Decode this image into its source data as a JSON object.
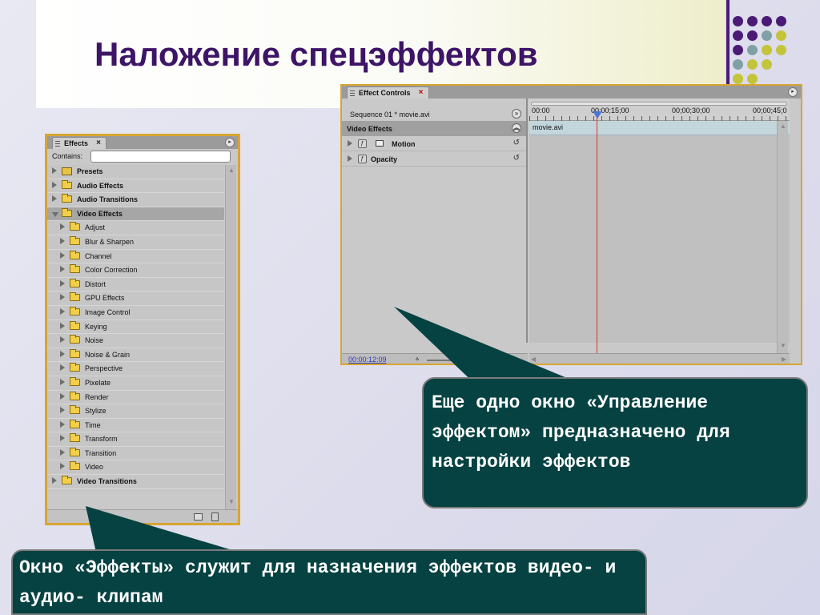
{
  "slide": {
    "title": "Наложение спецэффектов",
    "colors": {
      "title": "#3d1466",
      "callout_bg": "#064242",
      "accent_bar": "#4a1a75"
    },
    "decoration_dot_colors": [
      "#4a1a75",
      "#7fa1a6",
      "#c4c43a"
    ]
  },
  "effects_panel": {
    "tab_label": "Effects",
    "close_label": "×",
    "contains_label": "Contains:",
    "contains_value": "",
    "items": [
      {
        "label": "Presets",
        "level": 0,
        "open": false,
        "bold": true,
        "icon": "presets-icon"
      },
      {
        "label": "Audio Effects",
        "level": 0,
        "open": false,
        "bold": true,
        "icon": "folder-icon"
      },
      {
        "label": "Audio Transitions",
        "level": 0,
        "open": false,
        "bold": true,
        "icon": "folder-icon"
      },
      {
        "label": "Video Effects",
        "level": 0,
        "open": true,
        "bold": true,
        "selected": true,
        "icon": "folder-icon"
      },
      {
        "label": "Adjust",
        "level": 1,
        "icon": "folder-icon"
      },
      {
        "label": "Blur & Sharpen",
        "level": 1,
        "icon": "folder-icon"
      },
      {
        "label": "Channel",
        "level": 1,
        "icon": "folder-icon"
      },
      {
        "label": "Color Correction",
        "level": 1,
        "icon": "folder-icon"
      },
      {
        "label": "Distort",
        "level": 1,
        "icon": "folder-icon"
      },
      {
        "label": "GPU Effects",
        "level": 1,
        "icon": "folder-icon"
      },
      {
        "label": "Image Control",
        "level": 1,
        "icon": "folder-icon"
      },
      {
        "label": "Keying",
        "level": 1,
        "icon": "folder-icon"
      },
      {
        "label": "Noise",
        "level": 1,
        "icon": "folder-icon"
      },
      {
        "label": "Noise & Grain",
        "level": 1,
        "icon": "folder-icon"
      },
      {
        "label": "Perspective",
        "level": 1,
        "icon": "folder-icon"
      },
      {
        "label": "Pixelate",
        "level": 1,
        "icon": "folder-icon"
      },
      {
        "label": "Render",
        "level": 1,
        "icon": "folder-icon"
      },
      {
        "label": "Stylize",
        "level": 1,
        "icon": "folder-icon"
      },
      {
        "label": "Time",
        "level": 1,
        "icon": "folder-icon"
      },
      {
        "label": "Transform",
        "level": 1,
        "icon": "folder-icon"
      },
      {
        "label": "Transition",
        "level": 1,
        "icon": "folder-icon"
      },
      {
        "label": "Video",
        "level": 1,
        "icon": "folder-icon"
      },
      {
        "label": "Video Transitions",
        "level": 0,
        "open": false,
        "bold": true,
        "icon": "folder-icon"
      }
    ]
  },
  "effect_controls": {
    "tab_label": "Effect Controls",
    "close_label": "×",
    "sequence_label": "Sequence 01 * movie.avi",
    "section_label": "Video Effects",
    "effects": [
      {
        "label": "Motion",
        "icon": "motion-icon"
      },
      {
        "label": "Opacity",
        "icon": "fx-icon"
      }
    ],
    "ruler_ticks": [
      "00:00",
      "00;00;15;00",
      "00;00;30;00",
      "00;00;45;0"
    ],
    "clip_label": "movie.avi",
    "current_time": "00:00:12:09"
  },
  "callouts": {
    "effect_controls_note": "Еще одно окно «Управление эффектом» предназначено для настройки эффектов",
    "effects_note": "Окно «Эффекты» служит для назначения эффектов видео- и аудио- клипам"
  }
}
